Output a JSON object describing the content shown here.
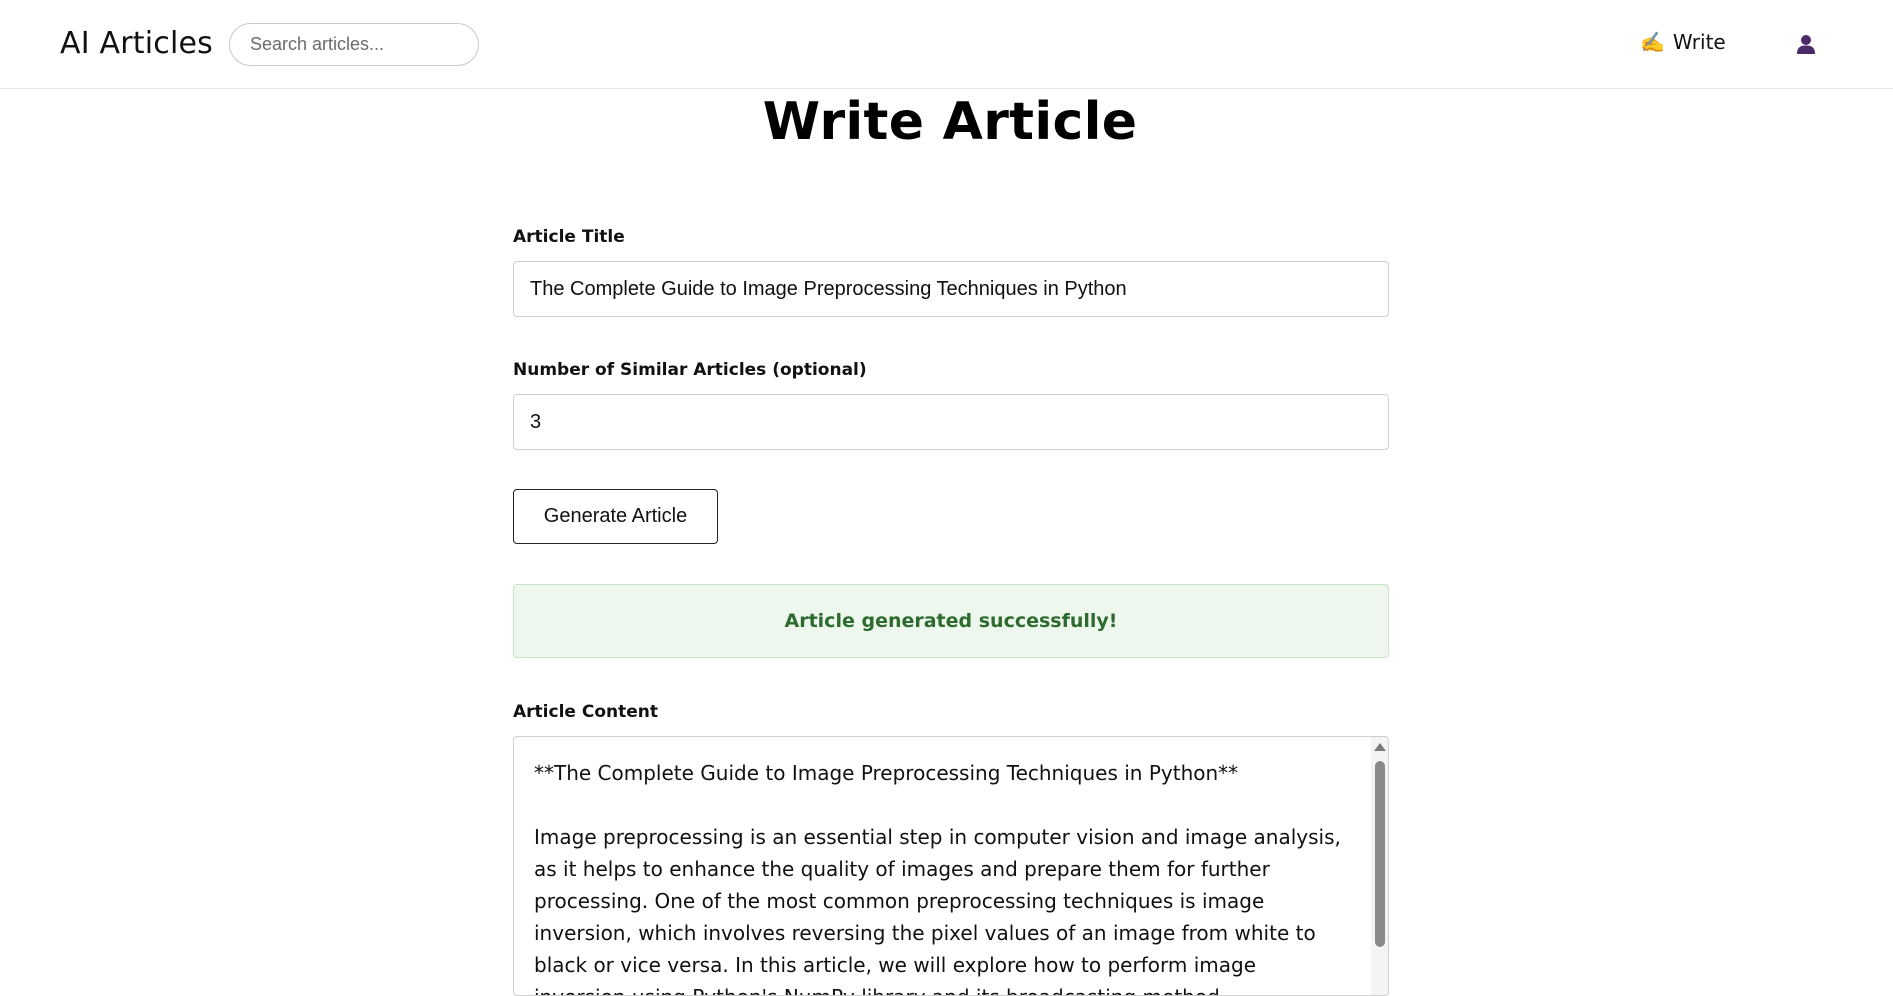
{
  "header": {
    "brand": "AI Articles",
    "search_placeholder": "Search articles...",
    "write_icon": "✍️",
    "write_label": "Write",
    "user_icon": "user-icon"
  },
  "page": {
    "title": "Write Article"
  },
  "form": {
    "title_label": "Article Title",
    "title_value": "The Complete Guide to Image Preprocessing Techniques in Python",
    "similar_label": "Number of Similar Articles (optional)",
    "similar_value": "3",
    "generate_label": "Generate Article",
    "success_message": "Article generated successfully!",
    "content_label": "Article Content",
    "content_text": "**The Complete Guide to Image Preprocessing Techniques in Python**\n\nImage preprocessing is an essential step in computer vision and image analysis, as it helps to enhance the quality of images and prepare them for further processing. One of the most common preprocessing techniques is image inversion, which involves reversing the pixel values of an image from white to black or vice versa. In this article, we will explore how to perform image inversion using Python's NumPy library and its broadcasting method."
  },
  "colors": {
    "success_bg": "#eef7ee",
    "success_text": "#2e6b2e",
    "user_icon": "#4b2a6b"
  }
}
